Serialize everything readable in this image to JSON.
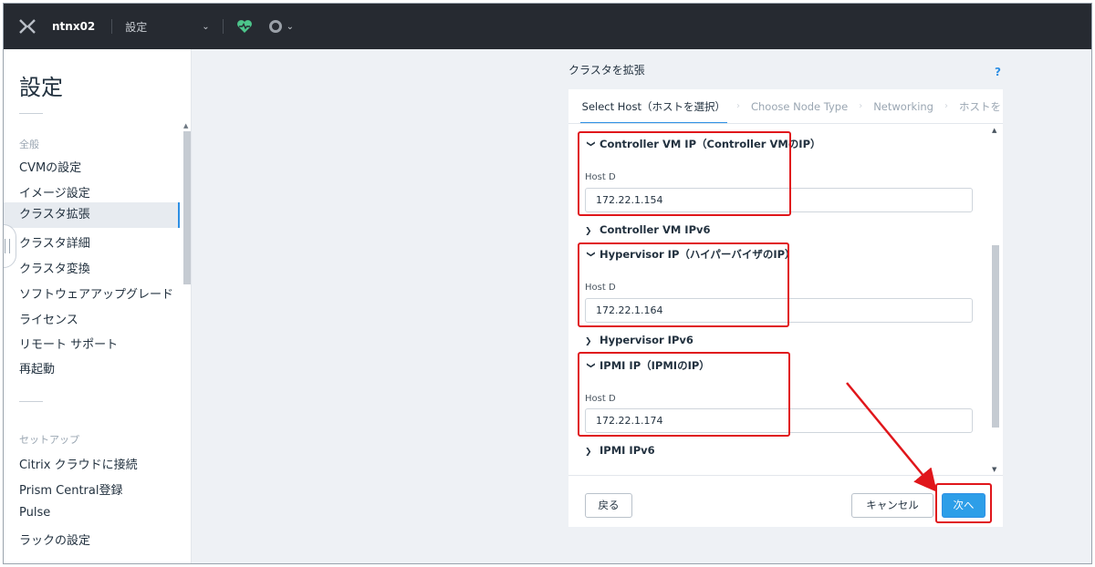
{
  "topbar": {
    "cluster_name": "ntnx02",
    "page_label": "設定",
    "page_dropdown_chevron": "⌄",
    "status_icon": "heart-pulse-icon",
    "health_color": "#4cc58b"
  },
  "sidebar": {
    "title": "設定",
    "sections": [
      {
        "label": "全般",
        "items": [
          "CVMの設定",
          "イメージ設定",
          "クラスタ拡張",
          "クラスタ詳細",
          "クラスタ変換",
          "ソフトウェアアップグレード",
          "ライセンス",
          "リモート サポート",
          "再起動"
        ]
      },
      {
        "label": "セットアップ",
        "items": [
          "Citrix クラウドに接続",
          "Prism Central登録",
          "Pulse",
          "ラックの設定"
        ]
      }
    ],
    "active_item": "クラスタ拡張"
  },
  "dialog": {
    "title": "クラスタを拡張",
    "help": "?",
    "steps": [
      "Select Host（ホストを選択）",
      "Choose Node Type",
      "Networking",
      "ホストを"
    ],
    "active_step": 0,
    "sections": [
      {
        "heading": "Controller VM IP（Controller VMのIP）",
        "expanded": true,
        "host_label": "Host D",
        "value": "172.22.1.154"
      },
      {
        "heading": "Controller VM IPv6",
        "expanded": false
      },
      {
        "heading": "Hypervisor IP（ハイパーバイザのIP）",
        "expanded": true,
        "host_label": "Host D",
        "value": "172.22.1.164"
      },
      {
        "heading": "Hypervisor IPv6",
        "expanded": false
      },
      {
        "heading": "IPMI IP（IPMIのIP）",
        "expanded": true,
        "host_label": "Host D",
        "value": "172.22.1.174"
      },
      {
        "heading": "IPMI IPv6",
        "expanded": false
      }
    ],
    "buttons": {
      "back": "戻る",
      "cancel": "キャンセル",
      "next": "次へ"
    }
  },
  "annotations": {
    "highlight_color": "#e0161b"
  }
}
